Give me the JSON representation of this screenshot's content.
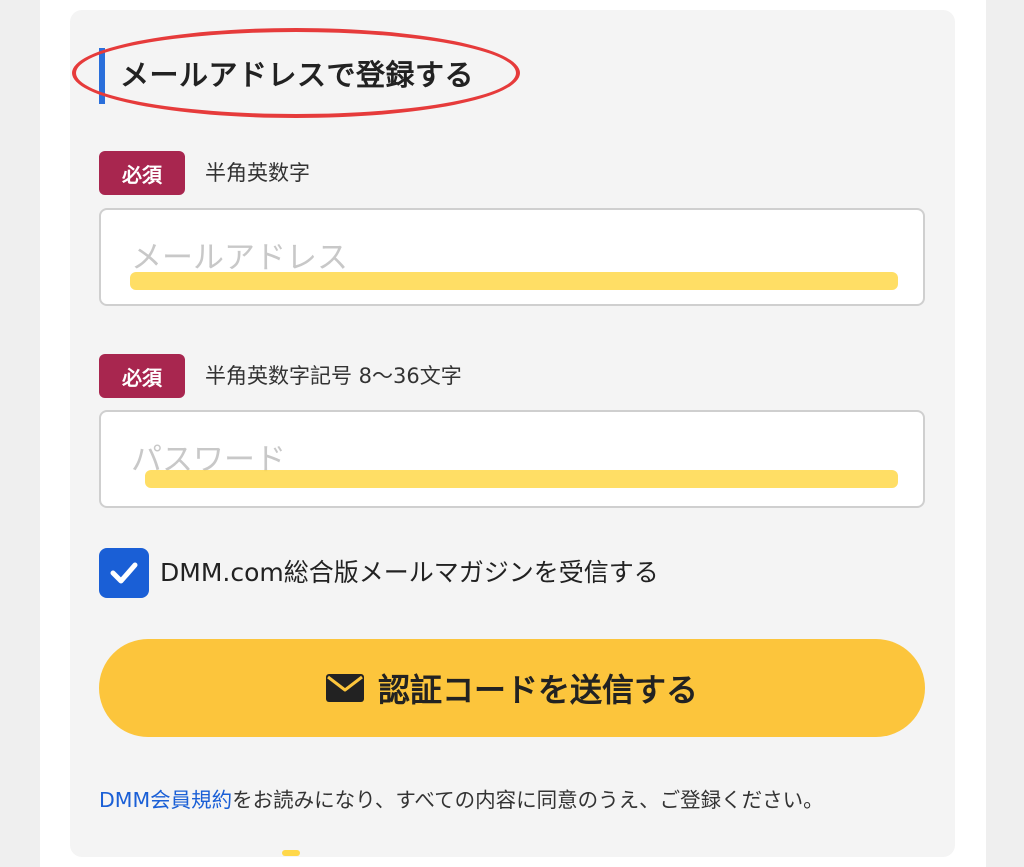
{
  "section": {
    "title": "メールアドレスで登録する"
  },
  "email_field": {
    "required_badge": "必須",
    "hint": "半角英数字",
    "placeholder": "メールアドレス"
  },
  "password_field": {
    "required_badge": "必須",
    "hint": "半角英数字記号 8〜36文字",
    "placeholder": "パスワード"
  },
  "newsletter": {
    "checked": true,
    "label": "DMM.com総合版メールマガジンを受信する"
  },
  "submit": {
    "label": "認証コードを送信する",
    "icon": "envelope-icon"
  },
  "terms": {
    "link_text": "DMM会員規約",
    "text": "をお読みになり、すべての内容に同意のうえ、ご登録ください。"
  },
  "colors": {
    "accent_blue": "#1a5fd6",
    "required_badge": "#a8264f",
    "button_yellow": "#fcc53c",
    "annotation_red": "#e63b3b",
    "highlight_yellow": "#ffd84a"
  }
}
